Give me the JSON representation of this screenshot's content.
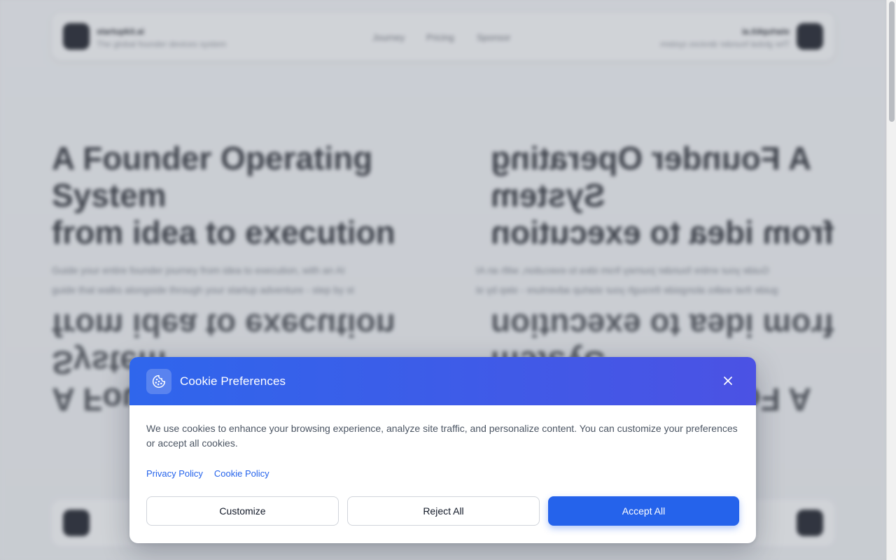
{
  "background": {
    "nav": {
      "brand_left": "startupkit.ai",
      "brand_left_sub": "The global founder devices system",
      "links": [
        "Journey",
        "Pricing",
        "Sponsor"
      ],
      "brand_right": "startupkit.ai",
      "brand_right_sub": "The global founder devices system"
    },
    "hero": {
      "line1": "A Founder Operating",
      "line2": "System",
      "line3": "from idea to execution",
      "paragraph_line1": "Guide your entire founder journey from idea to execution, with an AI",
      "paragraph_line2": "guide that walks alongside through your startup adventure - step by st"
    }
  },
  "modal": {
    "title": "Cookie Preferences",
    "body": "We use cookies to enhance your browsing experience, analyze site traffic, and personalize content. You can customize your preferences or accept all cookies.",
    "links": {
      "privacy": "Privacy Policy",
      "cookie": "Cookie Policy"
    },
    "buttons": {
      "customize": "Customize",
      "reject": "Reject All",
      "accept": "Accept All"
    },
    "icons": {
      "header": "cookie-icon",
      "close": "close-icon"
    },
    "colors": {
      "header_gradient_start": "#2f66ec",
      "header_gradient_end": "#4b52e4",
      "accent": "#2563eb",
      "link": "#2563eb"
    }
  }
}
